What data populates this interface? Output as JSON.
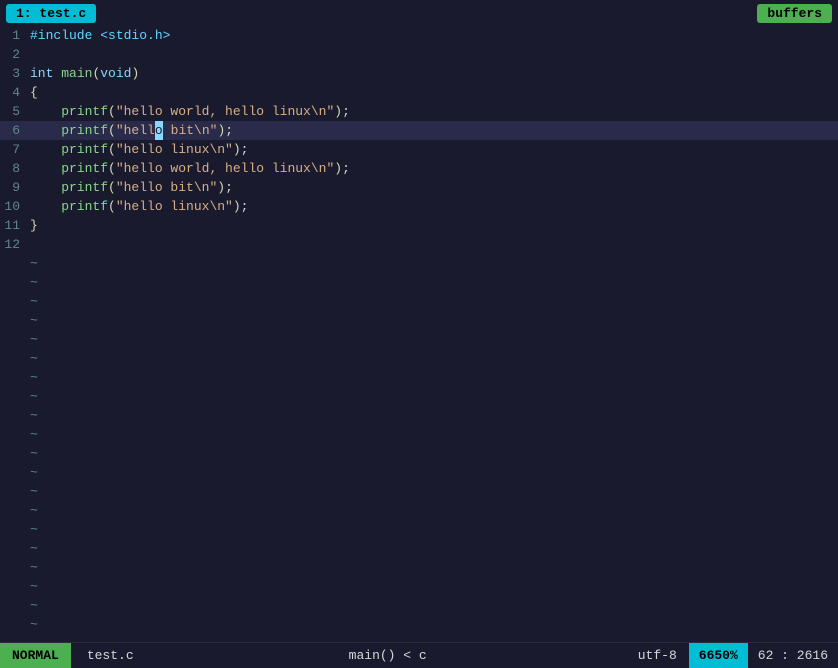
{
  "tab": {
    "label": "1: test.c"
  },
  "buffers_btn": {
    "label": "buffers"
  },
  "lines": [
    {
      "num": "1",
      "tokens": [
        {
          "t": "preprocessor",
          "v": "#include <stdio.h>"
        }
      ]
    },
    {
      "num": "2",
      "tokens": []
    },
    {
      "num": "3",
      "tokens": [
        {
          "t": "keyword",
          "v": "int"
        },
        {
          "t": "plain",
          "v": " "
        },
        {
          "t": "func",
          "v": "main"
        },
        {
          "t": "paren",
          "v": "("
        },
        {
          "t": "keyword",
          "v": "void"
        },
        {
          "t": "paren",
          "v": ")"
        }
      ]
    },
    {
      "num": "4",
      "tokens": [
        {
          "t": "brace",
          "v": "{"
        }
      ]
    },
    {
      "num": "5",
      "tokens": [
        {
          "t": "func",
          "v": "    printf"
        },
        {
          "t": "paren",
          "v": "("
        },
        {
          "t": "string",
          "v": "\"hello world, hello linux\\n\""
        },
        {
          "t": "paren",
          "v": ")"
        },
        {
          "t": "semi",
          "v": ";"
        }
      ]
    },
    {
      "num": "6",
      "tokens": [
        {
          "t": "func",
          "v": "    printf"
        },
        {
          "t": "paren",
          "v": "("
        },
        {
          "t": "string",
          "v": "\"hell"
        },
        {
          "t": "cursor",
          "v": "o"
        },
        {
          "t": "string",
          "v": " bit\\n\""
        },
        {
          "t": "paren",
          "v": ")"
        },
        {
          "t": "semi",
          "v": ";"
        }
      ],
      "highlight": true
    },
    {
      "num": "7",
      "tokens": [
        {
          "t": "func",
          "v": "    printf"
        },
        {
          "t": "paren",
          "v": "("
        },
        {
          "t": "string",
          "v": "\"hello linux\\n\""
        },
        {
          "t": "paren",
          "v": ")"
        },
        {
          "t": "semi",
          "v": ";"
        }
      ]
    },
    {
      "num": "8",
      "tokens": [
        {
          "t": "func",
          "v": "    printf"
        },
        {
          "t": "paren",
          "v": "("
        },
        {
          "t": "string",
          "v": "\"hello world, hello linux\\n\""
        },
        {
          "t": "paren",
          "v": ")"
        },
        {
          "t": "semi",
          "v": ";"
        }
      ]
    },
    {
      "num": "9",
      "tokens": [
        {
          "t": "func",
          "v": "    printf"
        },
        {
          "t": "paren",
          "v": "("
        },
        {
          "t": "string",
          "v": "\"hello bit\\n\""
        },
        {
          "t": "paren",
          "v": ")"
        },
        {
          "t": "semi",
          "v": ";"
        }
      ]
    },
    {
      "num": "10",
      "tokens": [
        {
          "t": "func",
          "v": "    printf"
        },
        {
          "t": "paren",
          "v": "("
        },
        {
          "t": "string",
          "v": "\"hello linux\\n\""
        },
        {
          "t": "paren",
          "v": ")"
        },
        {
          "t": "semi",
          "v": ";"
        }
      ]
    },
    {
      "num": "11",
      "tokens": [
        {
          "t": "brace",
          "v": "}"
        }
      ]
    },
    {
      "num": "12",
      "tokens": []
    }
  ],
  "tildes": [
    "~",
    "~",
    "~",
    "~",
    "~",
    "~",
    "~",
    "~",
    "~",
    "~",
    "~",
    "~",
    "~",
    "~",
    "~",
    "~",
    "~",
    "~",
    "~",
    "~",
    "~",
    "~"
  ],
  "status": {
    "mode": "NORMAL",
    "filename": "test.c",
    "position": "main() < c",
    "encoding": "utf-8",
    "percent": "6650%",
    "lineinfo": "62 : 2616"
  }
}
